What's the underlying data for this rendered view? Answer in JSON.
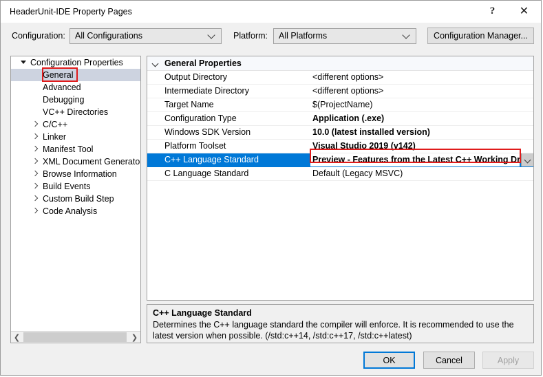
{
  "window": {
    "title": "HeaderUnit-IDE Property Pages",
    "help_icon": "question-mark-icon",
    "close_icon": "close-icon"
  },
  "toolbar": {
    "configuration_label": "Configuration:",
    "configuration_value": "All Configurations",
    "platform_label": "Platform:",
    "platform_value": "All Platforms",
    "configuration_manager_label": "Configuration Manager..."
  },
  "tree": {
    "nodes": [
      {
        "label": "Configuration Properties",
        "depth": 0,
        "expander": "open",
        "selected": false
      },
      {
        "label": "General",
        "depth": 1,
        "expander": "none",
        "selected": true
      },
      {
        "label": "Advanced",
        "depth": 1,
        "expander": "none",
        "selected": false
      },
      {
        "label": "Debugging",
        "depth": 1,
        "expander": "none",
        "selected": false
      },
      {
        "label": "VC++ Directories",
        "depth": 1,
        "expander": "none",
        "selected": false
      },
      {
        "label": "C/C++",
        "depth": 1,
        "expander": "closed",
        "selected": false
      },
      {
        "label": "Linker",
        "depth": 1,
        "expander": "closed",
        "selected": false
      },
      {
        "label": "Manifest Tool",
        "depth": 1,
        "expander": "closed",
        "selected": false
      },
      {
        "label": "XML Document Generator",
        "depth": 1,
        "expander": "closed",
        "selected": false
      },
      {
        "label": "Browse Information",
        "depth": 1,
        "expander": "closed",
        "selected": false
      },
      {
        "label": "Build Events",
        "depth": 1,
        "expander": "closed",
        "selected": false
      },
      {
        "label": "Custom Build Step",
        "depth": 1,
        "expander": "closed",
        "selected": false
      },
      {
        "label": "Code Analysis",
        "depth": 1,
        "expander": "closed",
        "selected": false
      }
    ],
    "scroll_left_icon": "chevron-left-icon",
    "scroll_right_icon": "chevron-right-icon"
  },
  "grid": {
    "group_label": "General Properties",
    "group_expander": "chevron-down-icon",
    "rows": [
      {
        "name": "Output Directory",
        "value": "<different options>",
        "bold": false,
        "selected": false
      },
      {
        "name": "Intermediate Directory",
        "value": "<different options>",
        "bold": false,
        "selected": false
      },
      {
        "name": "Target Name",
        "value": "$(ProjectName)",
        "bold": false,
        "selected": false
      },
      {
        "name": "Configuration Type",
        "value": "Application (.exe)",
        "bold": true,
        "selected": false
      },
      {
        "name": "Windows SDK Version",
        "value": "10.0 (latest installed version)",
        "bold": true,
        "selected": false
      },
      {
        "name": "Platform Toolset",
        "value": "Visual Studio 2019 (v142)",
        "bold": true,
        "selected": false
      },
      {
        "name": "C++ Language Standard",
        "value": "Preview - Features from the Latest C++ Working Draft",
        "bold": true,
        "selected": true
      },
      {
        "name": "C Language Standard",
        "value": "Default (Legacy MSVC)",
        "bold": false,
        "selected": false
      }
    ]
  },
  "description": {
    "title": "C++ Language Standard",
    "body": "Determines the C++ language standard the compiler will enforce. It is recommended to use the latest version when possible.  (/std:c++14, /std:c++17, /std:c++latest)"
  },
  "footer": {
    "ok_label": "OK",
    "cancel_label": "Cancel",
    "apply_label": "Apply"
  },
  "annotations": {
    "accent_color": "#e01b1b"
  }
}
